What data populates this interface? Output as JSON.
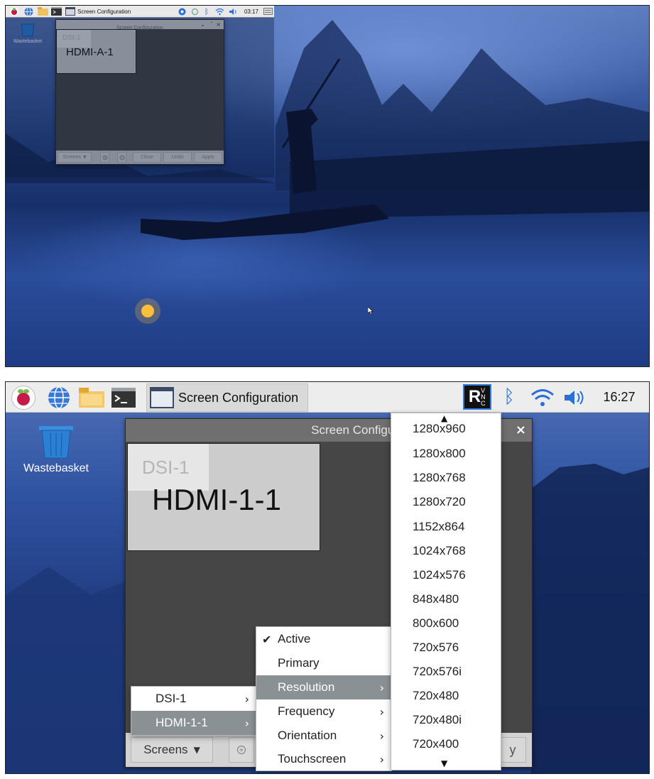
{
  "top": {
    "taskbar": {
      "window_title": "Screen Configuration",
      "clock": "03:17"
    },
    "desktop": {
      "wastebasket_label": "Wastebasket"
    },
    "window": {
      "title": "Screen Configuration",
      "controls": [
        "⌄",
        "ˆ",
        "×"
      ],
      "monitors": [
        "DSI-1",
        "HDMI-A-1"
      ],
      "buttons": {
        "screens": "Screens",
        "close": "Close",
        "undo": "Undo",
        "apply": "Apply"
      }
    }
  },
  "bottom": {
    "taskbar": {
      "window_title": "Screen Configuration",
      "clock": "16:27"
    },
    "desktop": {
      "wastebasket_label": "Wastebasket"
    },
    "window": {
      "title": "Screen Configuration",
      "close_glyph": "×",
      "monitors": [
        "DSI-1",
        "HDMI-1-1"
      ],
      "buttons": {
        "screens": "Screens",
        "apply_fragment": "y"
      }
    },
    "screens_menu": {
      "items": [
        {
          "label": "DSI-1",
          "highlighted": false
        },
        {
          "label": "HDMI-1-1",
          "highlighted": true
        }
      ]
    },
    "output_menu": {
      "items": [
        {
          "label": "Active",
          "checked": true,
          "submenu": false,
          "highlighted": false
        },
        {
          "label": "Primary",
          "checked": false,
          "submenu": false,
          "highlighted": false
        },
        {
          "label": "Resolution",
          "checked": false,
          "submenu": true,
          "highlighted": true
        },
        {
          "label": "Frequency",
          "checked": false,
          "submenu": true,
          "highlighted": false
        },
        {
          "label": "Orientation",
          "checked": false,
          "submenu": true,
          "highlighted": false
        },
        {
          "label": "Touchscreen",
          "checked": false,
          "submenu": true,
          "highlighted": false
        }
      ]
    },
    "resolution_menu": {
      "partial_top": "1280x960",
      "items": [
        "1280x800",
        "1280x768",
        "1280x720",
        "1152x864",
        "1024x768",
        "1024x576",
        "848x480",
        "800x600",
        "720x576",
        "720x576i",
        "720x480",
        "720x480i",
        "720x400"
      ]
    }
  },
  "colors": {
    "menu_highlight": "#8a9195",
    "window_body": "#464646",
    "monitor_hdmi": "#cccccc",
    "monitor_dsi": "#e6e6e6"
  }
}
